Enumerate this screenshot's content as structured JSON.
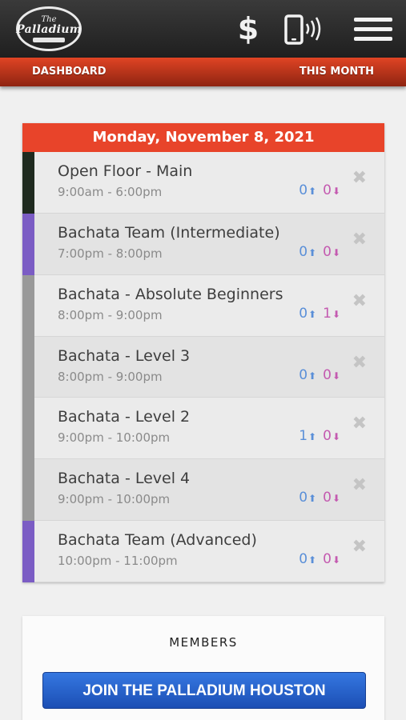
{
  "header": {
    "logo": {
      "line1": "The",
      "line2": "Palladium"
    },
    "icons": [
      "dollar-icon",
      "phone-signal-icon",
      "menu-icon"
    ],
    "dollar_symbol": "$"
  },
  "subnav": {
    "left": "DASHBOARD",
    "right": "THIS MONTH"
  },
  "schedule": {
    "date": "Monday, November 8, 2021",
    "accent": "#e8442a",
    "rows": [
      {
        "title": "Open Floor - Main",
        "time": "9:00am - 6:00pm",
        "male": "0",
        "female": "0",
        "color": "#1f2a1f"
      },
      {
        "title": "Bachata Team (Intermediate)",
        "time": "7:00pm - 8:00pm",
        "male": "0",
        "female": "0",
        "color": "#7b5cc4"
      },
      {
        "title": "Bachata - Absolute Beginners",
        "time": "8:00pm - 9:00pm",
        "male": "0",
        "female": "1",
        "color": "#999999"
      },
      {
        "title": "Bachata - Level 3",
        "time": "8:00pm - 9:00pm",
        "male": "0",
        "female": "0",
        "color": "#999999"
      },
      {
        "title": "Bachata - Level 2",
        "time": "9:00pm - 10:00pm",
        "male": "1",
        "female": "0",
        "color": "#999999"
      },
      {
        "title": "Bachata - Level 4",
        "time": "9:00pm - 10:00pm",
        "male": "0",
        "female": "0",
        "color": "#999999"
      },
      {
        "title": "Bachata Team (Advanced)",
        "time": "10:00pm - 11:00pm",
        "male": "0",
        "female": "0",
        "color": "#7b5cc4"
      }
    ]
  },
  "members": {
    "label": "MEMBERS",
    "join_button": "JOIN THE PALLADIUM HOUSTON"
  }
}
